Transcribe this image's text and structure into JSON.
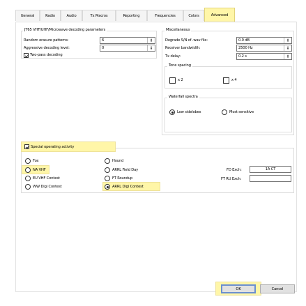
{
  "tabs": [
    "General",
    "Radio",
    "Audio",
    "Tx Macros",
    "Reporting",
    "Frequencies",
    "Colors",
    "Advanced"
  ],
  "jt65": {
    "title": "JT65 VHF/UHF/Microwave decoding parameters",
    "random_erasure_label": "Random erasure patterns:",
    "random_erasure_value": "6",
    "aggressive_label": "Aggressive decoding level:",
    "aggressive_value": "0",
    "two_pass_label": "Two-pass decoding",
    "two_pass_checked": true
  },
  "misc": {
    "title": "Miscellaneous",
    "degrade_label": "Degrade S/N of .wav file:",
    "degrade_value": "0.0 dB",
    "receiver_bw_label": "Receiver bandwidth:",
    "receiver_bw_value": "2500 Hz",
    "tx_delay_label": "Tx delay:",
    "tx_delay_value": "0.2 s",
    "tone_spacing_title": "Tone spacing",
    "x2_label": "x 2",
    "x4_label": "x 4",
    "waterfall_title": "Waterfall spectra",
    "low_sidelobes_label": "Low sidelobes",
    "most_sensitive_label": "Most sensitive",
    "low_sidelobes_selected": true
  },
  "special": {
    "title": "Special operating activity",
    "enabled": true,
    "options": [
      "Fox",
      "NA VHF",
      "EU VHF Contest",
      "WW Digi Contest",
      "Hound",
      "ARRL Field Day",
      "FT Roundup",
      "ARRL Digi Contest"
    ],
    "selected": "ARRL Digi Contest",
    "fd_exch_label": "FD Exch:",
    "fd_exch_value": "1A CT",
    "rtty_exch_label": "FT RU Exch:",
    "rtty_exch_value": ""
  },
  "buttons": {
    "ok": "OK",
    "cancel": "Cancel"
  },
  "colors": {
    "highlight": "#fff6a8",
    "primary_border": "#6b8fd0"
  }
}
